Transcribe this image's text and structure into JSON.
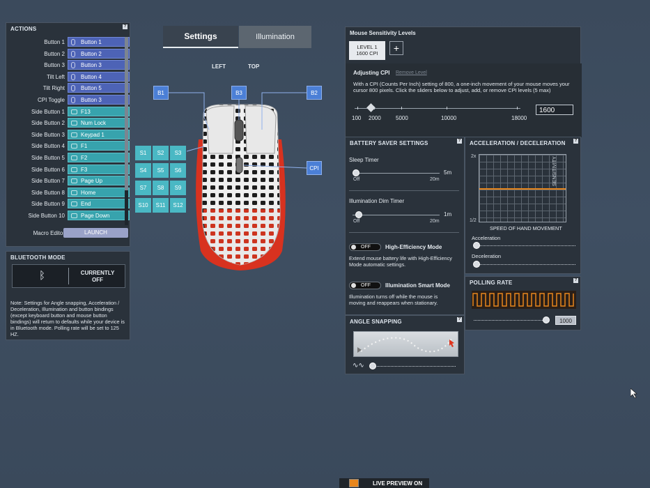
{
  "actions": {
    "title": "ACTIONS",
    "rows": [
      {
        "label": "Button 1",
        "value": "Button 1",
        "type": "mouse"
      },
      {
        "label": "Button 2",
        "value": "Button 2",
        "type": "mouse"
      },
      {
        "label": "Button 3",
        "value": "Button 3",
        "type": "mouse"
      },
      {
        "label": "Tilt Left",
        "value": "Button 4",
        "type": "mouse"
      },
      {
        "label": "Tilt Right",
        "value": "Button 5",
        "type": "mouse"
      },
      {
        "label": "CPI Toggle",
        "value": "Button 3",
        "type": "mouse"
      },
      {
        "label": "Side Button 1",
        "value": "F13",
        "type": "keyboard"
      },
      {
        "label": "Side Button 2",
        "value": "Num Lock",
        "type": "keyboard"
      },
      {
        "label": "Side Button 3",
        "value": "Keypad 1",
        "type": "keyboard"
      },
      {
        "label": "Side Button 4",
        "value": "F1",
        "type": "keyboard"
      },
      {
        "label": "Side Button 5",
        "value": "F2",
        "type": "keyboard"
      },
      {
        "label": "Side Button 6",
        "value": "F3",
        "type": "keyboard"
      },
      {
        "label": "Side Button 7",
        "value": "Page Up",
        "type": "keyboard"
      },
      {
        "label": "Side Button 8",
        "value": "Home",
        "type": "keyboard"
      },
      {
        "label": "Side Button 9",
        "value": "End",
        "type": "keyboard"
      },
      {
        "label": "Side Button 10",
        "value": "Page Down",
        "type": "keyboard"
      }
    ],
    "macro_label": "Macro Editor",
    "launch_label": "LAUNCH"
  },
  "bluetooth": {
    "title": "BLUETOOTH MODE",
    "status_line1": "CURRENTLY",
    "status_line2": "OFF",
    "note": "Note: Settings for Angle snapping, Acceleration / Deceleration, Illumination and button bindings (except keyboard button and mouse button bindings) will return to defaults while your device is in Bluetooth mode. Polling rate will be set to 125 HZ."
  },
  "tabs": {
    "settings": "Settings",
    "illumination": "Illumination"
  },
  "views": {
    "left": "LEFT",
    "top": "TOP"
  },
  "mouse_labels": {
    "b1": "B1",
    "b2": "B2",
    "b3": "B3",
    "cpi": "CPI",
    "side": [
      "S1",
      "S2",
      "S3",
      "S4",
      "S5",
      "S6",
      "S7",
      "S8",
      "S9",
      "S10",
      "S11",
      "S12"
    ]
  },
  "sensitivity": {
    "title": "Mouse Sensitivity Levels",
    "level_line1": "LEVEL 1",
    "level_line2": "1600 CPI",
    "add": "+",
    "adjusting": "Adjusting CPI",
    "remove": "Remove Level",
    "description": "With a CPI (Counts Per Inch) setting of 800, a one-inch movement of your mouse moves your cursor 800 pixels. Click the sliders below to adjust, add, or remove CPI levels (5 max)",
    "ticks": [
      "100",
      "2000",
      "5000",
      "10000",
      "18000"
    ],
    "value": "1600"
  },
  "battery": {
    "title": "BATTERY SAVER SETTINGS",
    "sleep_label": "Sleep Timer",
    "sleep_value": "5m",
    "sleep_min": "Off",
    "sleep_max": "20m",
    "dim_label": "Illumination Dim Timer",
    "dim_value": "1m",
    "dim_min": "Off",
    "dim_max": "20m",
    "he_toggle": "OFF",
    "he_label": "High-Efficiency Mode",
    "he_desc": "Extend mouse battery life with High-Efficiency Mode automatic settings.",
    "ism_toggle": "OFF",
    "ism_label": "Illumination Smart Mode",
    "ism_desc": "Illumination turns off while the mouse is moving and reappears when stationary."
  },
  "accel": {
    "title": "ACCELERATION / DECELERATION",
    "y_top": "2x",
    "y_bottom": "1/2",
    "y_label": "SENSITIVITY",
    "x_label": "SPEED OF HAND MOVEMENT",
    "accel_label": "Acceleration",
    "decel_label": "Deceleration"
  },
  "polling": {
    "title": "POLLING RATE",
    "value": "1000"
  },
  "angle": {
    "title": "ANGLE SNAPPING"
  },
  "bottom": {
    "live_preview": "LIVE PREVIEW ON"
  },
  "help": "?",
  "colors": {
    "blue_bind": "#4d63b6",
    "teal_bind": "#37a3ad",
    "orange": "#e8861c",
    "mouse_red": "#d8321f"
  }
}
